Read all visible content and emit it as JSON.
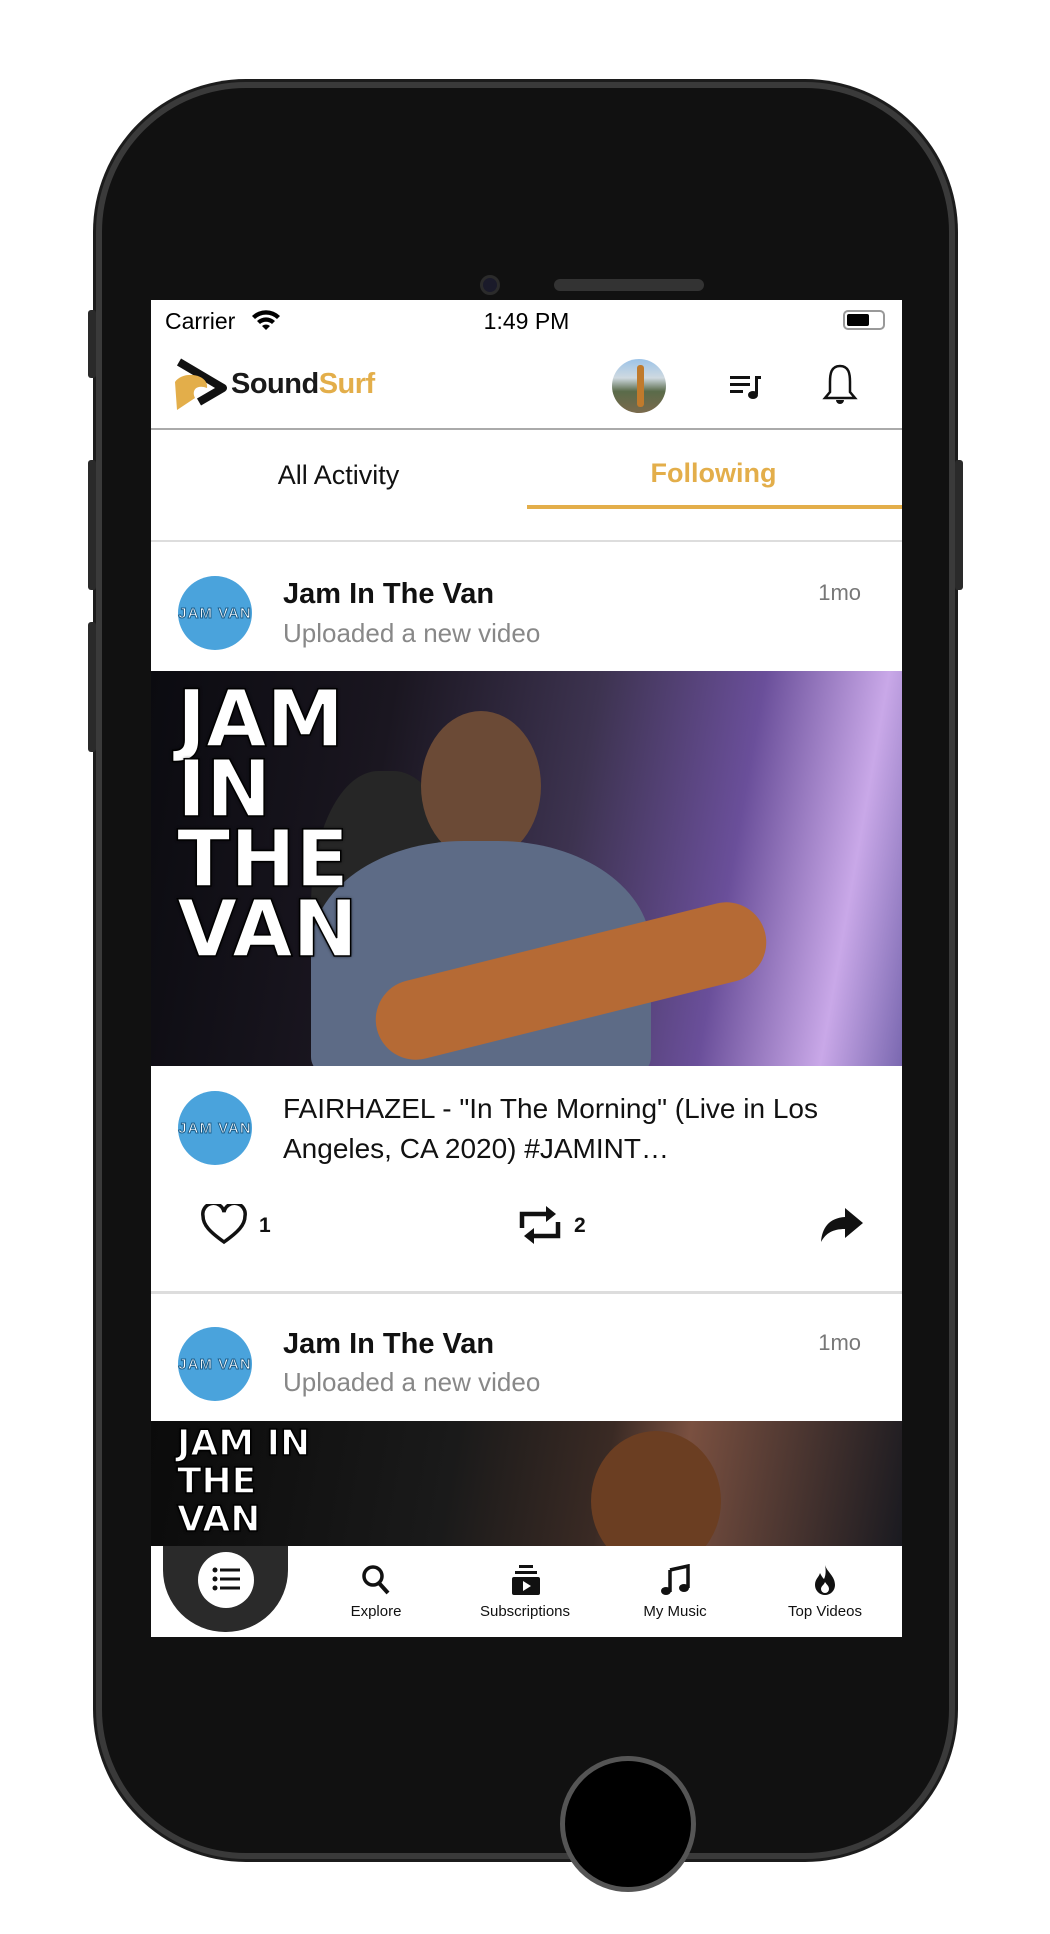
{
  "status_bar": {
    "carrier": "Carrier",
    "time": "1:49 PM"
  },
  "header": {
    "logo_sound": "Sound",
    "logo_surf": "Surf",
    "accent": "#E3AE4A"
  },
  "tabs": [
    {
      "label": "All Activity",
      "active": false
    },
    {
      "label": "Following",
      "active": true
    }
  ],
  "feed": [
    {
      "channel": "Jam In The Van",
      "action": "Uploaded a new video",
      "age": "1mo",
      "avatar_text": "JAM VAN",
      "thumbnail_text": "JAM IN THE VAN",
      "caption": "FAIRHAZEL - \"In The Morning\" (Live in Los Angeles, CA 2020) #JAMINT…",
      "likes": "1",
      "reposts": "2"
    },
    {
      "channel": "Jam In The Van",
      "action": "Uploaded a new video",
      "age": "1mo",
      "avatar_text": "JAM VAN",
      "thumbnail_text": "JAM IN THE VAN"
    }
  ],
  "bottom_nav": [
    {
      "label": "",
      "icon": "list-icon",
      "active": true
    },
    {
      "label": "Explore",
      "icon": "search-icon"
    },
    {
      "label": "Subscriptions",
      "icon": "subscriptions-icon"
    },
    {
      "label": "My Music",
      "icon": "music-note-icon"
    },
    {
      "label": "Top Videos",
      "icon": "fire-icon"
    }
  ]
}
